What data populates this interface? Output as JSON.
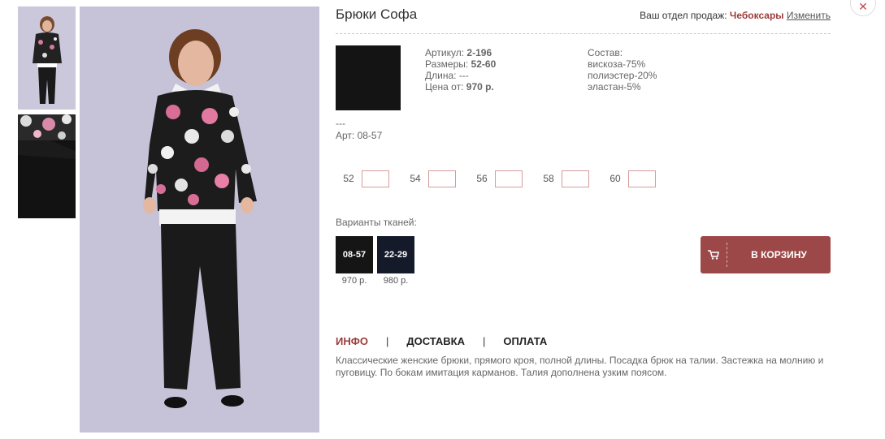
{
  "product": {
    "title": "Брюки Софа",
    "sales": {
      "prefix": "Ваш отдел продаж:",
      "city": "Чебоксары",
      "change": "Изменить"
    },
    "article_label": "Артикул:",
    "article": "2-196",
    "sizes_label": "Размеры:",
    "sizes_value": "52-60",
    "length_label": "Длина:",
    "length_value": "---",
    "price_label": "Цена от:",
    "price_value": "970 р.",
    "composition_label": "Состав:",
    "composition": [
      "вискоза-75%",
      "полиэстер-20%",
      "эластан-5%"
    ],
    "fabric_dash": "---",
    "fabric_art": "Арт: 08-57"
  },
  "size_inputs": [
    {
      "label": "52",
      "value": ""
    },
    {
      "label": "54",
      "value": ""
    },
    {
      "label": "56",
      "value": ""
    },
    {
      "label": "58",
      "value": ""
    },
    {
      "label": "60",
      "value": ""
    }
  ],
  "variants": {
    "label": "Варианты тканей:",
    "items": [
      {
        "code": "08-57",
        "price": "970 р.",
        "color": "#151515"
      },
      {
        "code": "22-29",
        "price": "980 р.",
        "color": "#151a2b"
      }
    ]
  },
  "cart": {
    "label": "В КОРЗИНУ",
    "icon": "cart-icon"
  },
  "tabs": [
    {
      "label": "ИНФО",
      "active": true
    },
    {
      "label": "ДОСТАВКА"
    },
    {
      "label": "ОПЛАТА"
    }
  ],
  "tab_separator": "|",
  "description": "Классические женские брюки, прямого кроя, полной длины. Посадка брюк на талии. Застежка на молнию и пуговицу. По бокам имитация карманов. Талия дополнена узким поясом.",
  "colors": {
    "accent": "#9c3b3b",
    "button": "#9d4848"
  },
  "close_icon": "close-icon"
}
